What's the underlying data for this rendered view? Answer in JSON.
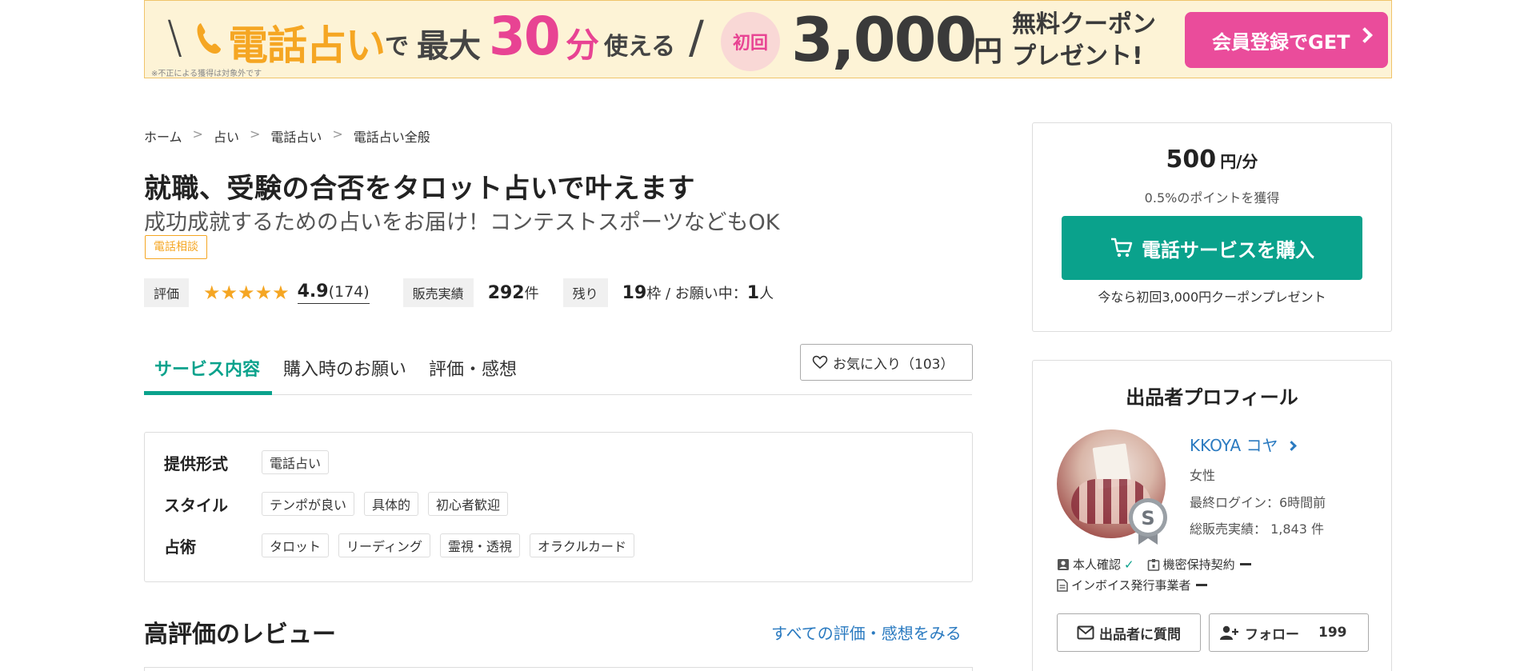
{
  "banner": {
    "tel_label": "電話占い",
    "de": "で",
    "max": "最大",
    "minutes": "30",
    "min_unit": "分",
    "use": "使える",
    "first_time": "初回",
    "amount": "3,000",
    "yen": "円",
    "free_coupon_line1": "無料クーポン",
    "free_coupon_line2": "プレゼント!",
    "cta_label": "会員登録でGET",
    "note": "※不正による獲得は対象外です",
    "colors": {
      "accent_pink": "#ea4c9b",
      "accent_orange": "#f5a623",
      "bg": "#fdf3d6"
    }
  },
  "breadcrumb": [
    {
      "label": "ホーム"
    },
    {
      "label": "占い"
    },
    {
      "label": "電話占い"
    },
    {
      "label": "電話占い全般"
    }
  ],
  "breadcrumb_sep": ">",
  "service": {
    "title": "就職、受験の合否をタロット占いで叶えます",
    "subtitle": "成功成就するための占いをお届け！コンテストスポーツなどもOK",
    "category": "電話相談"
  },
  "stats": {
    "rating_label": "評価",
    "stars": "★★★★★",
    "rating": "4.9",
    "rating_count": "(174)",
    "sales_label": "販売実績",
    "sales_count": "292",
    "sales_unit": "件",
    "remain_label": "残り",
    "remain_count": "19",
    "remain_unit": "枠 / お願い中：",
    "requests_count": "1",
    "requests_unit": "人"
  },
  "tabs": [
    {
      "label": "サービス内容",
      "active": true
    },
    {
      "label": "購入時のお願い",
      "active": false
    },
    {
      "label": "評価・感想",
      "active": false
    }
  ],
  "favorite": {
    "label": "お気に入り（103）"
  },
  "specs": {
    "format_key": "提供形式",
    "format_values": [
      "電話占い"
    ],
    "style_key": "スタイル",
    "style_values": [
      "テンポが良い",
      "具体的",
      "初心者歓迎"
    ],
    "method_key": "占術",
    "method_values": [
      "タロット",
      "リーディング",
      "霊視・透視",
      "オラクルカード"
    ]
  },
  "reviews": {
    "title": "高評価のレビュー",
    "all_link": "すべての評価・感想をみる"
  },
  "purchase": {
    "price": "500",
    "price_unit": "円/分",
    "points": "0.5%のポイントを獲得",
    "buy_label": "電話サービスを購入",
    "coupon_note": "今なら初回3,000円クーポンプレゼント",
    "accent": "#0aa28c"
  },
  "profile": {
    "title": "出品者プロフィール",
    "name": "KKOYA コヤ",
    "gender": "女性",
    "last_login": "最終ログイン：6時間前",
    "total_sales": "総販売実績： 1,843 件",
    "rank": "S",
    "identity_verified": "本人確認",
    "nda": "機密保持契約",
    "invoice": "インボイス発行事業者",
    "ask_label": "出品者に質問",
    "follow_label": "フォロー",
    "follow_count": "199"
  }
}
